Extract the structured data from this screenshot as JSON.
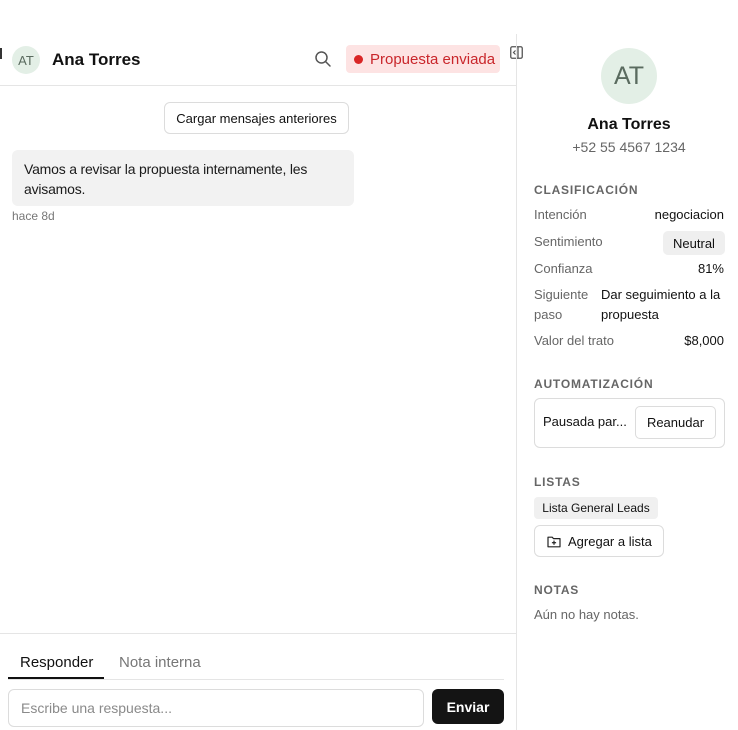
{
  "conversation": {
    "contact_initials": "AT",
    "contact_name": "Ana Torres",
    "status_label": "Propuesta enviada",
    "status_color": "#d92626",
    "load_more_label": "Cargar mensajes anteriores",
    "messages": [
      {
        "text": "Vamos a revisar la propuesta internamente, les avisamos.",
        "time": "hace 8d"
      }
    ],
    "composer": {
      "tabs": [
        "Responder",
        "Nota interna"
      ],
      "active_tab": "Responder",
      "placeholder": "Escribe una respuesta...",
      "value": "",
      "send_label": "Enviar"
    }
  },
  "side": {
    "initials": "AT",
    "name": "Ana Torres",
    "phone": "+52 55 4567 1234",
    "classification": {
      "title": "CLASIFICACIÓN",
      "intent_label": "Intención",
      "intent_value": "negociacion",
      "sentiment_label": "Sentimiento",
      "sentiment_value": "Neutral",
      "confidence_label": "Confianza",
      "confidence_value": "81%",
      "next_step_label": "Siguiente paso",
      "next_step_value": "Dar seguimiento a la propuesta",
      "deal_value_label": "Valor del trato",
      "deal_value": "$8,000"
    },
    "automation": {
      "title": "AUTOMATIZACIÓN",
      "status": "Pausada par...",
      "resume_label": "Reanudar"
    },
    "lists": {
      "title": "LISTAS",
      "items": [
        "Lista General Leads"
      ],
      "add_label": "Agregar a lista"
    },
    "notes": {
      "title": "NOTAS",
      "empty": "Aún no hay notas."
    }
  },
  "icons": {
    "search": "search-icon",
    "panel_toggle": "panel-toggle-icon",
    "folder_plus": "folder-plus-icon"
  }
}
